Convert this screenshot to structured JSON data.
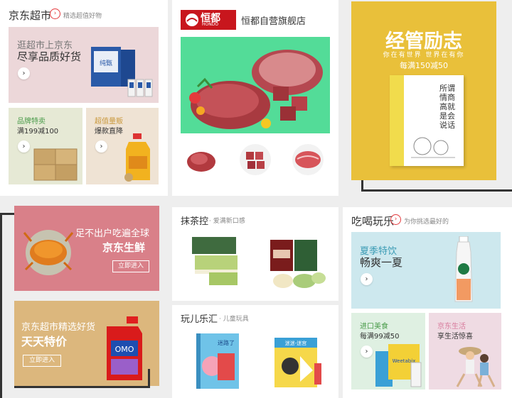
{
  "supermarket": {
    "title": "京东超市",
    "subtitle": "精选超值好物",
    "hero": {
      "title": "逛超市上京东",
      "desc": "尽享品质好货"
    },
    "card_left": {
      "title": "品牌特卖",
      "desc": "满199减100"
    },
    "card_right": {
      "title": "超值量贩",
      "desc": "爆款直降"
    }
  },
  "hengdu": {
    "logo_text": "恒都",
    "logo_sub": "HONDO",
    "store_name": "恒都自营旗舰店"
  },
  "book_promo": {
    "title": "经管励志",
    "slogan": "你在有世界 世界在有你",
    "deal": "每满150减50",
    "book_title": "所谓情商高就是会说话"
  },
  "fresh": {
    "slogan": "足不出户吃遍全球",
    "title": "京东生鲜",
    "button": "立即进入"
  },
  "daily_deals": {
    "line1": "京东超市精选好货",
    "line2": "天天特价",
    "button": "立即进入"
  },
  "matcha": {
    "title": "抹茶控",
    "subtitle": "· 爱满新口感"
  },
  "kids": {
    "title": "玩儿乐汇",
    "subtitle": "· 儿童玩具",
    "book_label": "迷路了",
    "box_label": "迷迷-迷宫"
  },
  "eat_play": {
    "title": "吃喝玩乐",
    "subtitle": "为你挑选最好的",
    "hero": {
      "title": "夏季特饮",
      "desc": "畅爽一夏"
    },
    "card_left": {
      "title": "进口美食",
      "desc": "每满99减50"
    },
    "card_right": {
      "title": "京东生活",
      "desc": "享生活惊喜"
    }
  },
  "product_labels": {
    "milk": "纯甄",
    "detergent": "OMO",
    "cereal": "Weetabix"
  },
  "colors": {
    "accent": "#e4393c",
    "gold": "#e9c03a",
    "fresh_bg": "#d98089",
    "tan_bg": "#dcb77d"
  }
}
